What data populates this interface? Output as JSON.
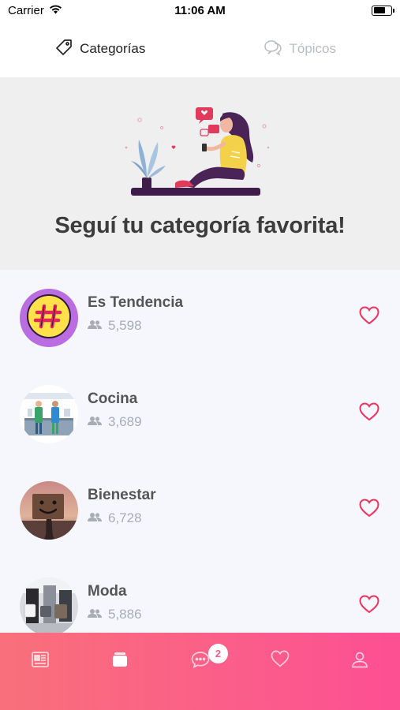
{
  "status_bar": {
    "carrier": "Carrier",
    "time": "11:06 AM"
  },
  "tabs": [
    {
      "label": "Categorías",
      "icon": "tag-icon",
      "active": true
    },
    {
      "label": "Tópicos",
      "icon": "chat-bubbles-icon",
      "active": false
    }
  ],
  "hero": {
    "title": "Seguí tu categoría favorita!"
  },
  "categories": [
    {
      "name": "Es Tendencia",
      "followers": "5,598",
      "icon": "hashtag-avatar"
    },
    {
      "name": "Cocina",
      "followers": "3,689",
      "icon": "kitchen-avatar"
    },
    {
      "name": "Bienestar",
      "followers": "6,728",
      "icon": "smiley-sign-avatar"
    },
    {
      "name": "Moda",
      "followers": "5,886",
      "icon": "fashion-avatar"
    }
  ],
  "bottom_nav": {
    "items": [
      "news-icon",
      "categories-icon",
      "messages-icon",
      "favorites-icon",
      "profile-icon"
    ],
    "messages_badge": "2"
  },
  "colors": {
    "accent": "#fb5d8a",
    "heart": "#f0325f",
    "nav_start": "#f9707a",
    "nav_end": "#fd4f93"
  }
}
